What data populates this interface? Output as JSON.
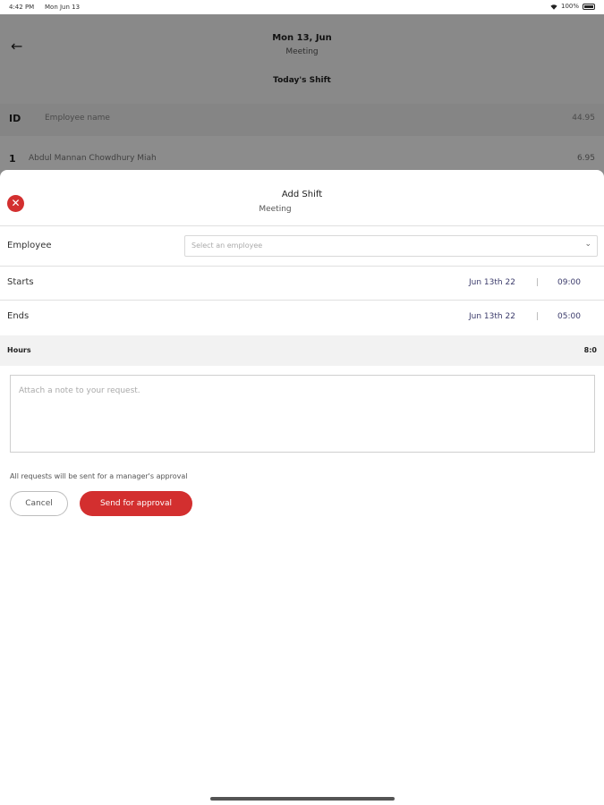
{
  "status_bar": {
    "time": "4:42 PM",
    "date": "Mon Jun 13",
    "battery": "100%"
  },
  "background": {
    "title": "Mon 13, Jun",
    "subtitle": "Meeting",
    "section_title": "Today's Shift",
    "table_header": {
      "id": "ID",
      "name": "Employee name",
      "hours": "44.95"
    },
    "rows": [
      {
        "id": "1",
        "name": "Abdul Mannan Chowdhury Miah",
        "hours": "6.95"
      }
    ]
  },
  "sheet": {
    "title": "Add Shift",
    "subtitle": "Meeting",
    "employee_label": "Employee",
    "employee_placeholder": "Select an employee",
    "starts_label": "Starts",
    "starts_date": "Jun 13th 22",
    "starts_time": "09:00",
    "ends_label": "Ends",
    "ends_date": "Jun 13th 22",
    "ends_time": "05:00",
    "separator": "|",
    "hours_label": "Hours",
    "hours_value": "8:0",
    "note_placeholder": "Attach a note to your request.",
    "approval_text": "All requests will be sent for a manager's approval",
    "cancel_label": "Cancel",
    "send_label": "Send for approval"
  },
  "colors": {
    "accent": "#d32f2f",
    "overlay": "rgba(0,0,0,0.45)"
  }
}
